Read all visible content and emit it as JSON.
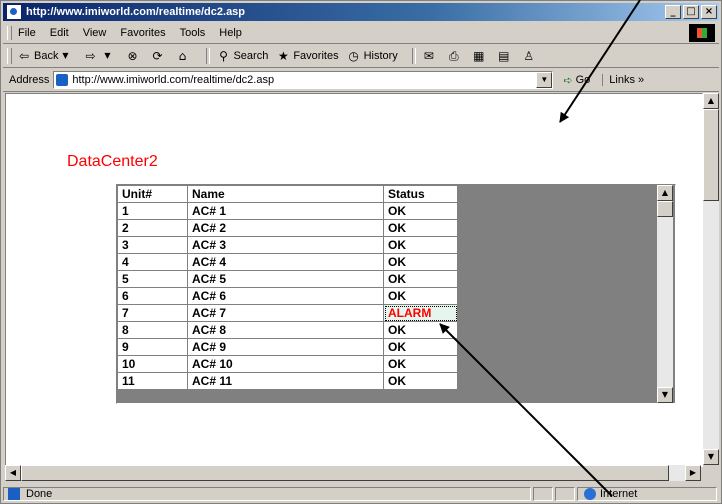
{
  "window": {
    "title": "http://www.imiworld.com/realtime/dc2.asp"
  },
  "menu": [
    "File",
    "Edit",
    "View",
    "Favorites",
    "Tools",
    "Help"
  ],
  "toolbar": {
    "back": "Back",
    "search": "Search",
    "favorites": "Favorites",
    "history": "History"
  },
  "address": {
    "label": "Address",
    "url": "http://www.imiworld.com/realtime/dc2.asp",
    "go": "Go",
    "links": "Links"
  },
  "page": {
    "title": "DataCenter2",
    "table": {
      "headers": [
        "Unit#",
        "Name",
        "Status"
      ],
      "rows": [
        [
          "1",
          "AC# 1",
          "OK"
        ],
        [
          "2",
          "AC# 2",
          "OK"
        ],
        [
          "3",
          "AC# 3",
          "OK"
        ],
        [
          "4",
          "AC# 4",
          "OK"
        ],
        [
          "5",
          "AC# 5",
          "OK"
        ],
        [
          "6",
          "AC# 6",
          "OK"
        ],
        [
          "7",
          "AC# 7",
          "ALARM"
        ],
        [
          "8",
          "AC# 8",
          "OK"
        ],
        [
          "9",
          "AC# 9",
          "OK"
        ],
        [
          "10",
          "AC# 10",
          "OK"
        ],
        [
          "11",
          "AC# 11",
          "OK"
        ]
      ]
    }
  },
  "status": {
    "text": "Done",
    "zone": "Internet"
  },
  "colors": {
    "alarm": "#ff0000",
    "title": "#ff0000",
    "titlebar": "#0a246a"
  }
}
